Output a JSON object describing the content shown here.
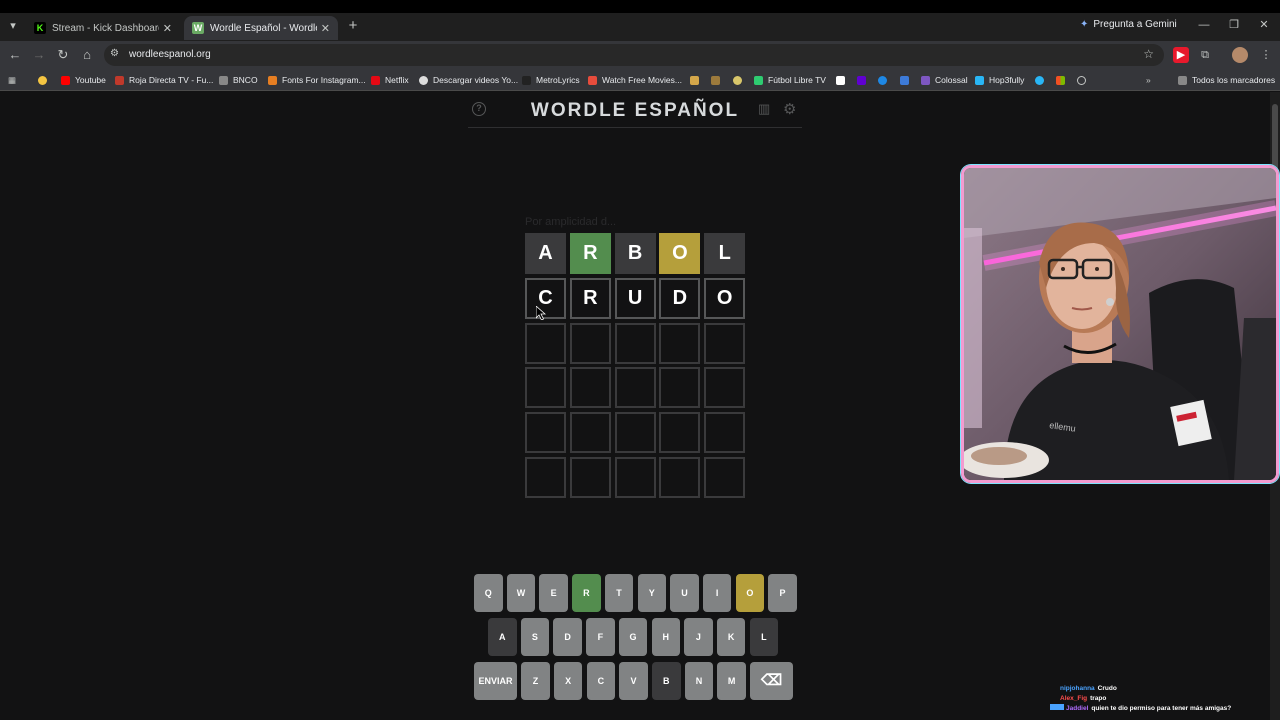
{
  "browser": {
    "tabs": [
      {
        "title": "Stream - Kick Dashboard",
        "favicon": "K",
        "favicon_color": "#53fc18",
        "active": false
      },
      {
        "title": "Wordle Español - Wordle ilimitado",
        "favicon": "W",
        "favicon_color": "#6aaa64",
        "active": true
      }
    ],
    "gemini_label": "Pregunta a Gemini",
    "url": "wordleespanol.org",
    "bookmarks": [
      {
        "label": "",
        "color": "#f4c542"
      },
      {
        "label": "Youtube",
        "color": "#ff0000"
      },
      {
        "label": "Roja Directa TV - Fu...",
        "color": "#c0392b"
      },
      {
        "label": "BNCO",
        "color": "#888888"
      },
      {
        "label": "Fonts For Instagram...",
        "color": "#e67e22"
      },
      {
        "label": "Netflix",
        "color": "#e50914"
      },
      {
        "label": "Descargar videos Yo...",
        "color": "#dddddd"
      },
      {
        "label": "MetroLyrics",
        "color": "#222222"
      },
      {
        "label": "Watch Free Movies...",
        "color": "#e74c3c"
      },
      {
        "label": "Fútbol Libre TV",
        "color": "#2ecc71"
      },
      {
        "label": "Colossal",
        "color": "#7e57c2"
      },
      {
        "label": "Hop3fully",
        "color": "#29b6f6"
      },
      {
        "label": "Todos los marcadores",
        "color": "#888888"
      }
    ]
  },
  "wordle": {
    "title": "WORDLE ESPAÑOL",
    "hint": "Por amplicidad d... ",
    "rows": [
      [
        {
          "letter": "A",
          "state": "absent"
        },
        {
          "letter": "R",
          "state": "correct"
        },
        {
          "letter": "B",
          "state": "absent"
        },
        {
          "letter": "O",
          "state": "present"
        },
        {
          "letter": "L",
          "state": "absent"
        }
      ],
      [
        {
          "letter": "C",
          "state": "filled"
        },
        {
          "letter": "R",
          "state": "filled"
        },
        {
          "letter": "U",
          "state": "filled"
        },
        {
          "letter": "D",
          "state": "filled"
        },
        {
          "letter": "O",
          "state": "filled"
        }
      ],
      [
        {
          "letter": "",
          "state": "empty"
        },
        {
          "letter": "",
          "state": "empty"
        },
        {
          "letter": "",
          "state": "empty"
        },
        {
          "letter": "",
          "state": "empty"
        },
        {
          "letter": "",
          "state": "empty"
        }
      ],
      [
        {
          "letter": "",
          "state": "empty"
        },
        {
          "letter": "",
          "state": "empty"
        },
        {
          "letter": "",
          "state": "empty"
        },
        {
          "letter": "",
          "state": "empty"
        },
        {
          "letter": "",
          "state": "empty"
        }
      ],
      [
        {
          "letter": "",
          "state": "empty"
        },
        {
          "letter": "",
          "state": "empty"
        },
        {
          "letter": "",
          "state": "empty"
        },
        {
          "letter": "",
          "state": "empty"
        },
        {
          "letter": "",
          "state": "empty"
        }
      ],
      [
        {
          "letter": "",
          "state": "empty"
        },
        {
          "letter": "",
          "state": "empty"
        },
        {
          "letter": "",
          "state": "empty"
        },
        {
          "letter": "",
          "state": "empty"
        },
        {
          "letter": "",
          "state": "empty"
        }
      ]
    ],
    "keyboard": [
      [
        {
          "k": "Q",
          "s": ""
        },
        {
          "k": "W",
          "s": ""
        },
        {
          "k": "E",
          "s": ""
        },
        {
          "k": "R",
          "s": "correct"
        },
        {
          "k": "T",
          "s": ""
        },
        {
          "k": "Y",
          "s": ""
        },
        {
          "k": "U",
          "s": ""
        },
        {
          "k": "I",
          "s": ""
        },
        {
          "k": "O",
          "s": "present"
        },
        {
          "k": "P",
          "s": ""
        }
      ],
      [
        {
          "k": "A",
          "s": "absent"
        },
        {
          "k": "S",
          "s": ""
        },
        {
          "k": "D",
          "s": ""
        },
        {
          "k": "F",
          "s": ""
        },
        {
          "k": "G",
          "s": ""
        },
        {
          "k": "H",
          "s": ""
        },
        {
          "k": "J",
          "s": ""
        },
        {
          "k": "K",
          "s": ""
        },
        {
          "k": "L",
          "s": "absent"
        }
      ],
      [
        {
          "k": "ENVIAR",
          "s": "",
          "wide": true
        },
        {
          "k": "Z",
          "s": ""
        },
        {
          "k": "X",
          "s": ""
        },
        {
          "k": "C",
          "s": ""
        },
        {
          "k": "V",
          "s": ""
        },
        {
          "k": "B",
          "s": "absent"
        },
        {
          "k": "N",
          "s": ""
        },
        {
          "k": "M",
          "s": ""
        },
        {
          "k": "⌫",
          "s": "",
          "wide": true
        }
      ]
    ]
  },
  "chat": [
    {
      "user": "nipjohanna",
      "user_color": "#4aa3ff",
      "message": "Crudo"
    },
    {
      "user": "Alex_Fig",
      "user_color": "#ff4d4d",
      "message": "trapo"
    },
    {
      "user": "Jaddiel",
      "user_color": "#b06cff",
      "message": "quien te dio permiso para tener más amigas?"
    }
  ]
}
